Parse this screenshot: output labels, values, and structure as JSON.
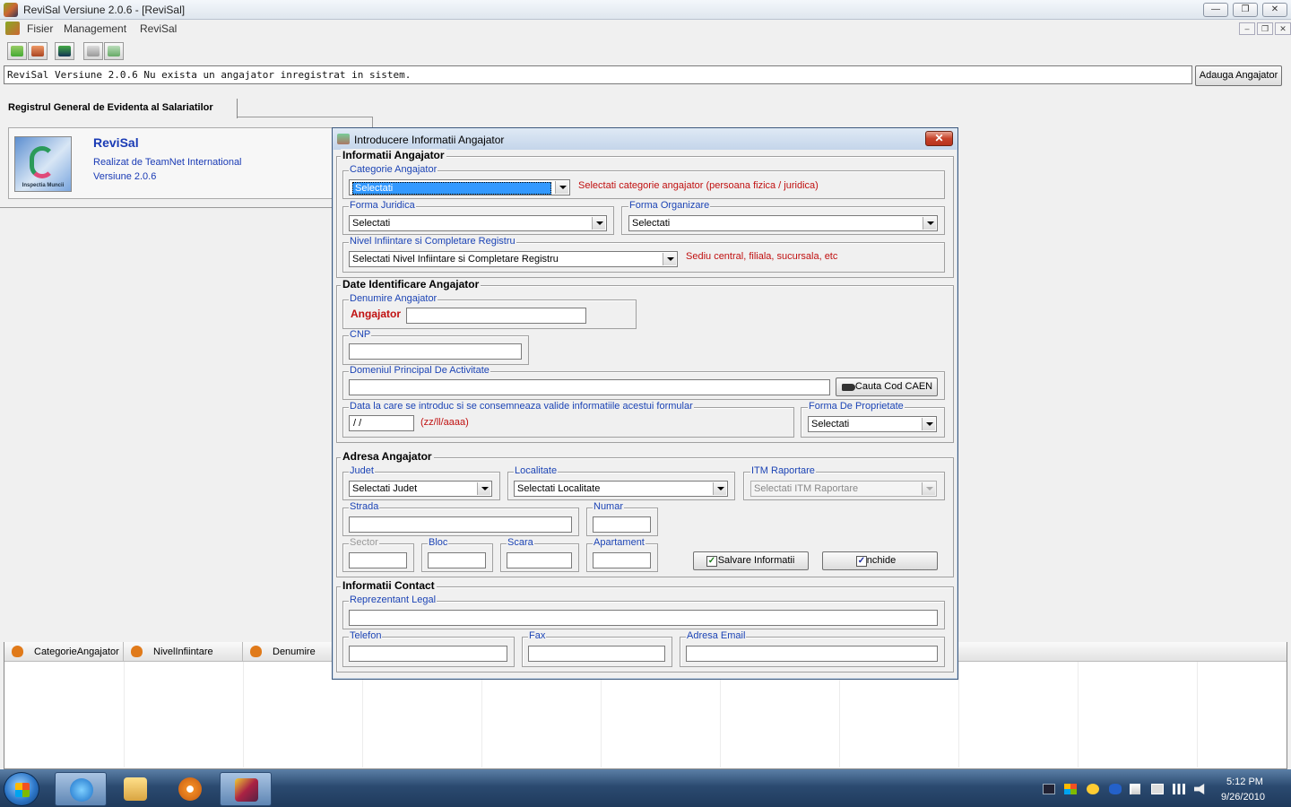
{
  "window": {
    "title": "ReviSal Versiune 2.0.6 - [ReviSal]",
    "min": "—",
    "max": "❐",
    "close": "✕"
  },
  "menu": {
    "items": [
      "Fisier",
      "Management",
      "ReviSal"
    ],
    "mdi_min": "–",
    "mdi_max": "❐",
    "mdi_close": "✕"
  },
  "status": {
    "text": "ReviSal Versiune 2.0.6 Nu exista un angajator inregistrat in sistem.",
    "add_button": "Adauga Angajator"
  },
  "tab": {
    "label": "Registrul General de Evidenta al Salariatilor"
  },
  "info": {
    "name": "ReviSal",
    "by": "Realizat de TeamNet International",
    "version": "Versiune 2.0.6",
    "logo_text": "Inspectia Muncii"
  },
  "grid": {
    "columns": [
      "CategorieAngajator",
      "NivelInfiintare",
      "Denumire"
    ]
  },
  "dialog": {
    "title": "Introducere Informatii Angajator",
    "close": "✕",
    "sec_info": "Informatii Angajator",
    "categorie": {
      "label": "Categorie Angajator",
      "value": "Selectati",
      "hint": "Selectati categorie angajator (persoana fizica / juridica)"
    },
    "forma_juridica": {
      "label": "Forma Juridica",
      "value": "Selectati"
    },
    "forma_organizare": {
      "label": "Forma Organizare",
      "value": "Selectati"
    },
    "nivel": {
      "label": "Nivel Infiintare si Completare Registru",
      "value": "Selectati Nivel Infiintare si Completare Registru",
      "hint": "Sediu central, filiala, sucursala, etc"
    },
    "sec_date": "Date Identificare Angajator",
    "denumire": {
      "label": "Denumire Angajator",
      "prefix": "Angajator"
    },
    "cnp": {
      "label": "CNP"
    },
    "domeniu": {
      "label": "Domeniul Principal De Activitate",
      "button": "Cauta Cod CAEN"
    },
    "data": {
      "label": "Data la care se introduc si se consemneaza valide informatiile acestui formular",
      "value": " /  /",
      "hint": "(zz/ll/aaaa)"
    },
    "forma_proprietate": {
      "label": "Forma De Proprietate",
      "value": "Selectati"
    },
    "sec_adresa": "Adresa Angajator",
    "judet": {
      "label": "Judet",
      "value": "Selectati Judet"
    },
    "localitate": {
      "label": "Localitate",
      "value": "Selectati Localitate"
    },
    "itm": {
      "label": "ITM Raportare",
      "value": "Selectati ITM Raportare"
    },
    "strada": {
      "label": "Strada"
    },
    "numar": {
      "label": "Numar"
    },
    "sector": {
      "label": "Sector"
    },
    "bloc": {
      "label": "Bloc"
    },
    "scara": {
      "label": "Scara"
    },
    "apartament": {
      "label": "Apartament"
    },
    "save_button": "Salvare Informatii",
    "close_button": "Inchide",
    "check_mark": "✓",
    "sec_contact": "Informatii Contact",
    "reprezentant": {
      "label": "Reprezentant Legal"
    },
    "telefon": {
      "label": "Telefon"
    },
    "fax": {
      "label": "Fax"
    },
    "email": {
      "label": "Adresa Email"
    }
  },
  "taskbar": {
    "time": "5:12 PM",
    "date": "9/26/2010"
  },
  "colors": {
    "accent_blue": "#1c44b5",
    "hint_red": "#c01010",
    "taskbar": "#2b4a70"
  }
}
